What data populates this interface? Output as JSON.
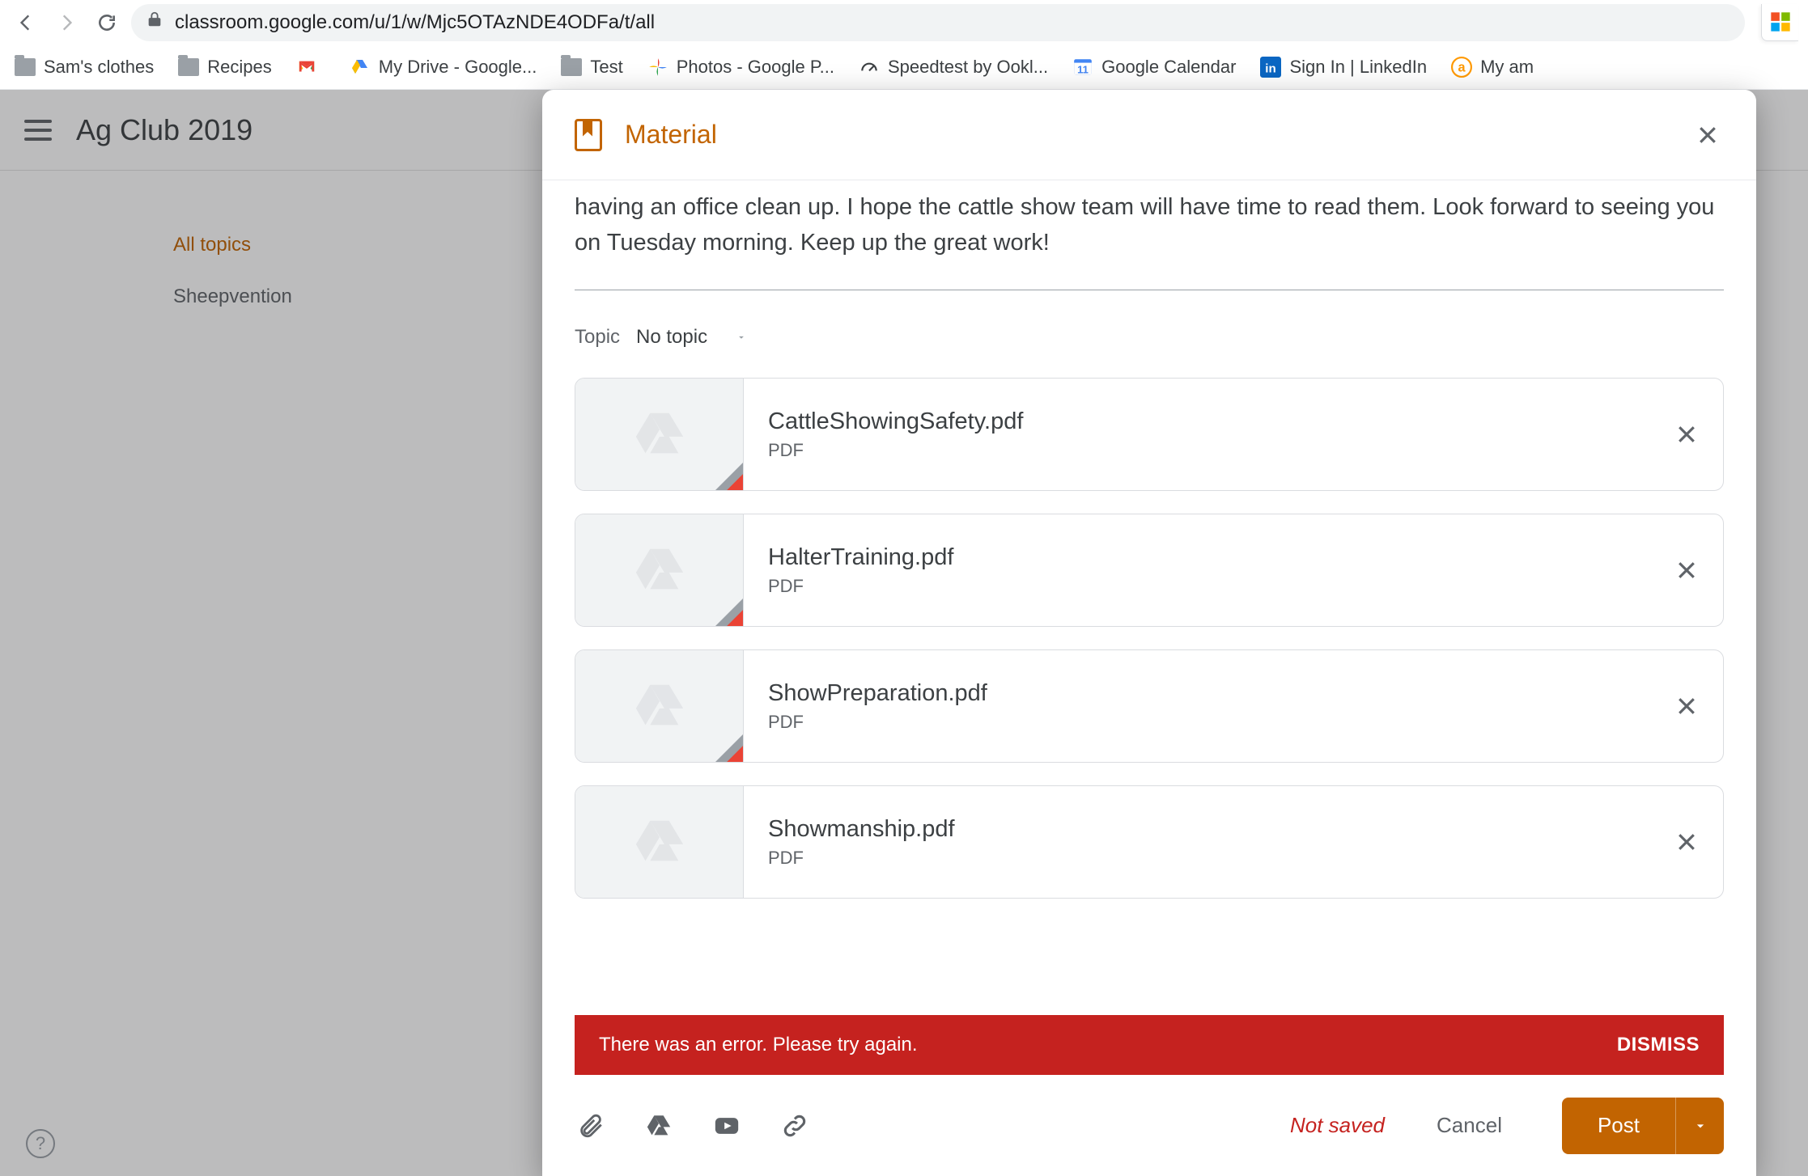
{
  "browser": {
    "url": "classroom.google.com/u/1/w/Mjc5OTAzNDE4ODFa/t/all",
    "bookmarks": [
      {
        "label": "Sam's clothes",
        "icon": "folder"
      },
      {
        "label": "Recipes",
        "icon": "folder"
      },
      {
        "label": "",
        "icon": "gmail"
      },
      {
        "label": "My Drive - Google...",
        "icon": "drive"
      },
      {
        "label": "Test",
        "icon": "folder"
      },
      {
        "label": "Photos - Google P...",
        "icon": "photos"
      },
      {
        "label": "Speedtest by Ookl...",
        "icon": "gauge"
      },
      {
        "label": "Google Calendar",
        "icon": "calendar"
      },
      {
        "label": "Sign In | LinkedIn",
        "icon": "linkedin"
      },
      {
        "label": "My am",
        "icon": "amazon"
      }
    ]
  },
  "classroom": {
    "class_title": "Ag Club 2019",
    "topics": {
      "all": "All topics",
      "items": [
        "Sheepvention"
      ]
    },
    "help": "?"
  },
  "modal": {
    "title": "Material",
    "description_visible": "having an office clean up. I hope the cattle show team will have time to read them. Look forward to seeing you on Tuesday morning. Keep up the great work!",
    "topic_label": "Topic",
    "topic_value": "No topic",
    "attachments": [
      {
        "name": "CattleShowingSafety.pdf",
        "type": "PDF"
      },
      {
        "name": "HalterTraining.pdf",
        "type": "PDF"
      },
      {
        "name": "ShowPreparation.pdf",
        "type": "PDF"
      },
      {
        "name": "Showmanship.pdf",
        "type": "PDF"
      }
    ],
    "error": {
      "text": "There was an error. Please try again.",
      "dismiss": "DISMISS"
    },
    "footer": {
      "not_saved": "Not saved",
      "cancel": "Cancel",
      "post": "Post"
    }
  }
}
